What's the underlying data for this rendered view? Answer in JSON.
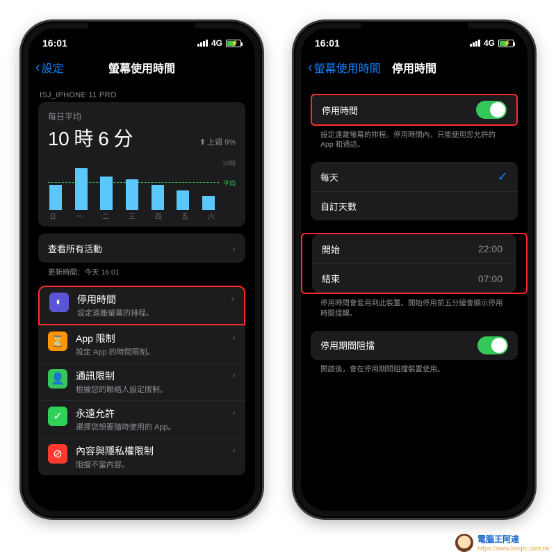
{
  "status": {
    "time": "16:01",
    "net": "4G"
  },
  "left": {
    "back": "設定",
    "title": "螢幕使用時間",
    "section_header": "ISJ_IPHONE 11 PRO",
    "daily_label": "每日平均",
    "daily_value": "10 時 6 分",
    "trend": "上週 9%",
    "see_all": "查看所有活動",
    "updated": "更新時間：今天 16:01",
    "items": [
      {
        "title": "停用時間",
        "sub": "設定遠離螢幕的排程。",
        "icon": "moon",
        "color": "i-purple",
        "hi": true
      },
      {
        "title": "App 限制",
        "sub": "設定 App 的時間限制。",
        "icon": "hourglass",
        "color": "i-orange"
      },
      {
        "title": "通訊限制",
        "sub": "根據您的聯絡人設定限制。",
        "icon": "person",
        "color": "i-green"
      },
      {
        "title": "永遠允許",
        "sub": "選擇您想要隨時使用的 App。",
        "icon": "check",
        "color": "i-green2"
      },
      {
        "title": "內容與隱私權限制",
        "sub": "阻擋不當內容。",
        "icon": "nosign",
        "color": "i-red"
      }
    ]
  },
  "right": {
    "back": "螢幕使用時間",
    "title": "停用時間",
    "toggle_label": "停用時間",
    "toggle_note": "設定遠離螢幕的排程。停用時間內，只能使用您允許的 App 和通話。",
    "every_day": "每天",
    "custom_days": "自訂天數",
    "start_label": "開始",
    "start_value": "22:00",
    "end_label": "結束",
    "end_value": "07:00",
    "time_note": "停用時間會套用到此裝置。開始停用前五分鐘會顯示停用時間提醒。",
    "block_label": "停用期間阻擋",
    "block_note": "開啟後，會在停用期間阻擋裝置使用。"
  },
  "chart_data": {
    "type": "bar",
    "categories": [
      "日",
      "一",
      "二",
      "三",
      "四",
      "五",
      "六"
    ],
    "values": [
      9,
      15,
      12,
      11,
      9,
      7,
      5
    ],
    "ylabel": "",
    "ylim": [
      0,
      16
    ],
    "ymax_label": "16時",
    "avg_label": "平均",
    "avg_value": 10.1,
    "title": "每日平均 10 時 6 分"
  },
  "watermark": {
    "name": "電腦王阿達",
    "url": "https://www.kocpc.com.tw"
  }
}
